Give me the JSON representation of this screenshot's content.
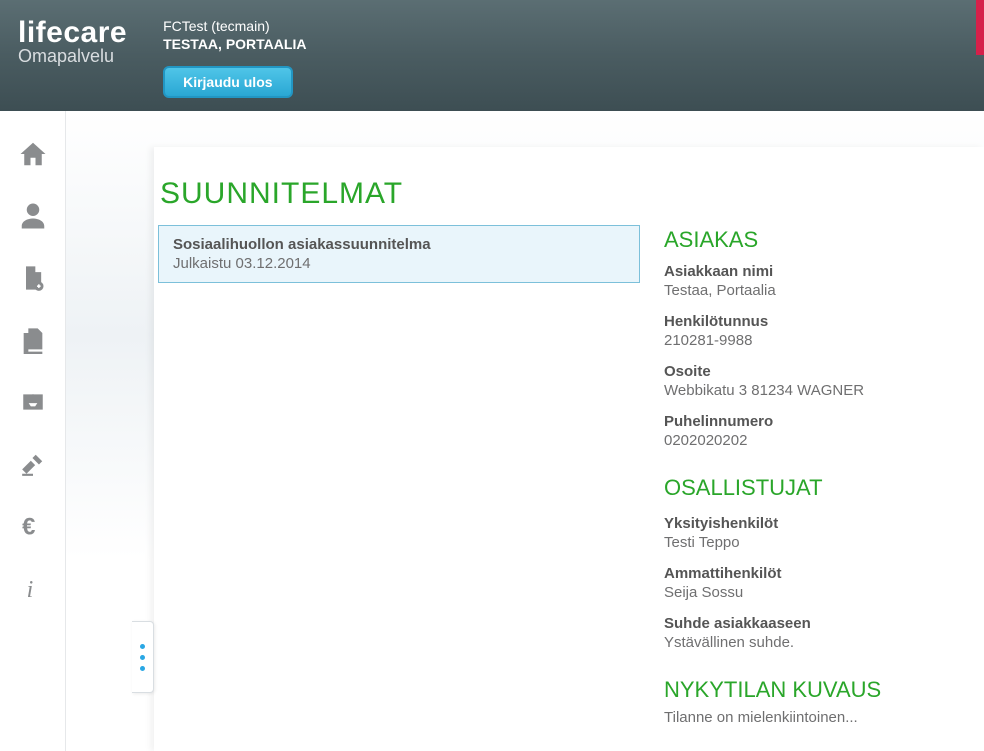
{
  "header": {
    "logo_main": "lifecare",
    "logo_sub": "Omapalvelu",
    "context_line1": "FCTest (tecmain)",
    "context_line2": "TESTAA, PORTAALIA",
    "logout_label": "Kirjaudu ulos"
  },
  "page": {
    "title": "SUUNNITELMAT"
  },
  "plan": {
    "title": "Sosiaalihuollon asiakassuunnitelma",
    "published_label": "Julkaistu 03.12.2014"
  },
  "asiakas": {
    "heading": "ASIAKAS",
    "name_label": "Asiakkaan nimi",
    "name_value": "Testaa, Portaalia",
    "ssn_label": "Henkilötunnus",
    "ssn_value": "210281-9988",
    "address_label": "Osoite",
    "address_value": "Webbikatu 3 81234 WAGNER",
    "phone_label": "Puhelinnumero",
    "phone_value": "0202020202"
  },
  "osallistujat": {
    "heading": "OSALLISTUJAT",
    "private_label": "Yksityishenkilöt",
    "private_value": "Testi Teppo",
    "pro_label": "Ammattihenkilöt",
    "pro_value": "Seija Sossu",
    "relation_label": "Suhde asiakkaaseen",
    "relation_value": "Ystävällinen suhde."
  },
  "nykytilan": {
    "heading": "NYKYTILAN KUVAUS",
    "value": "Tilanne on mielenkiintoinen..."
  },
  "sidebar_icons": [
    "home-icon",
    "person-icon",
    "new-document-icon",
    "documents-icon",
    "inbox-icon",
    "gavel-icon",
    "euro-icon",
    "info-icon"
  ]
}
